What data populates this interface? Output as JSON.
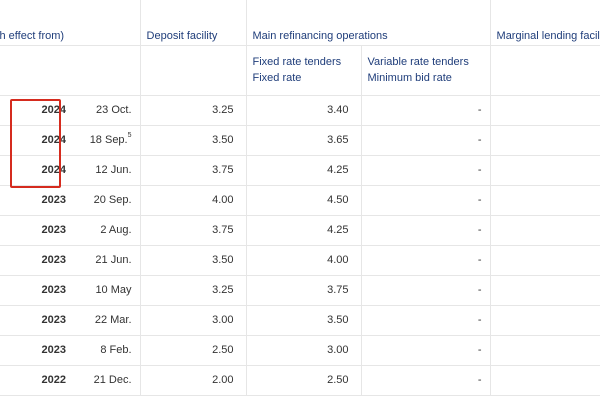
{
  "headers": {
    "effect": "ith effect from)",
    "deposit": "Deposit facility",
    "mro": "Main refinancing operations",
    "marginal": "Marginal lending faciliti"
  },
  "subheaders": {
    "fixed_line1": "Fixed rate tenders",
    "fixed_line2": "Fixed rate",
    "variable_line1": "Variable rate tenders",
    "variable_line2": "Minimum bid rate"
  },
  "rows": [
    {
      "year": "2024",
      "date": "23 Oct.",
      "sup": "",
      "deposit": "3.25",
      "fixed": "3.40",
      "variable": "-"
    },
    {
      "year": "2024",
      "date": "18 Sep.",
      "sup": "5",
      "deposit": "3.50",
      "fixed": "3.65",
      "variable": "-"
    },
    {
      "year": "2024",
      "date": "12 Jun.",
      "sup": "",
      "deposit": "3.75",
      "fixed": "4.25",
      "variable": "-"
    },
    {
      "year": "2023",
      "date": "20 Sep.",
      "sup": "",
      "deposit": "4.00",
      "fixed": "4.50",
      "variable": "-"
    },
    {
      "year": "2023",
      "date": "2 Aug.",
      "sup": "",
      "deposit": "3.75",
      "fixed": "4.25",
      "variable": "-"
    },
    {
      "year": "2023",
      "date": "21 Jun.",
      "sup": "",
      "deposit": "3.50",
      "fixed": "4.00",
      "variable": "-"
    },
    {
      "year": "2023",
      "date": "10 May",
      "sup": "",
      "deposit": "3.25",
      "fixed": "3.75",
      "variable": "-"
    },
    {
      "year": "2023",
      "date": "22 Mar.",
      "sup": "",
      "deposit": "3.00",
      "fixed": "3.50",
      "variable": "-"
    },
    {
      "year": "2023",
      "date": "8 Feb.",
      "sup": "",
      "deposit": "2.50",
      "fixed": "3.00",
      "variable": "-"
    },
    {
      "year": "2022",
      "date": "21 Dec.",
      "sup": "",
      "deposit": "2.00",
      "fixed": "2.50",
      "variable": "-"
    }
  ],
  "colors": {
    "header_text": "#1f3d7a",
    "highlight_border": "#d52b1e",
    "grid_line": "#e6e6e6"
  }
}
